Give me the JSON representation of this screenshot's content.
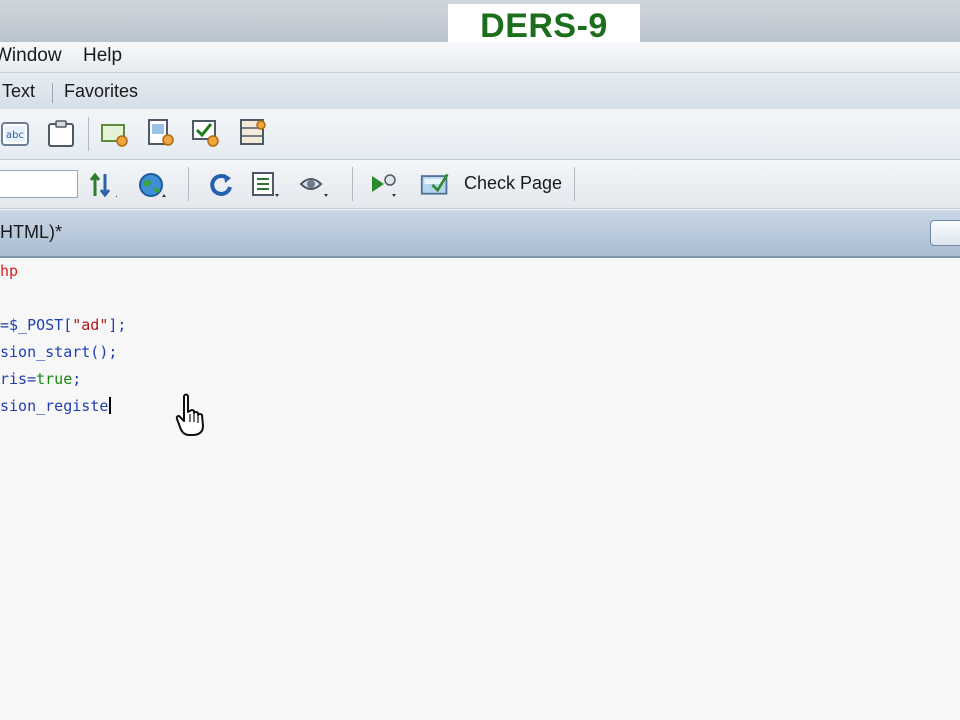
{
  "lesson_badge": "DERS-9",
  "menu": {
    "items": [
      "Window",
      "Help"
    ]
  },
  "insert_bar": {
    "tabs": [
      "Text",
      "Favorites"
    ]
  },
  "document_toolbar": {
    "check_page_label": "Check Page"
  },
  "document_tab": {
    "title": "HTML)*"
  },
  "editor": {
    "lines": [
      {
        "tokens": [
          {
            "t": "hp",
            "c": "kw-red"
          }
        ]
      },
      {
        "tokens": []
      },
      {
        "tokens": [
          {
            "t": "=$_POST[",
            "c": "op"
          },
          {
            "t": "\"ad\"",
            "c": "str"
          },
          {
            "t": "];",
            "c": "op"
          }
        ]
      },
      {
        "tokens": [
          {
            "t": "sion_start();",
            "c": "fn"
          }
        ]
      },
      {
        "tokens": [
          {
            "t": "ris",
            "c": "fn"
          },
          {
            "t": "=",
            "c": "op"
          },
          {
            "t": "true",
            "c": "kw-green"
          },
          {
            "t": ";",
            "c": "op"
          }
        ]
      },
      {
        "tokens": [
          {
            "t": "sion_registe",
            "c": "fn"
          }
        ]
      }
    ]
  },
  "colors": {
    "badge_text": "#1c6e1c",
    "keyword": "#d11f1f",
    "function": "#1f3fb0",
    "string": "#b01818",
    "boolean": "#148a14"
  },
  "icons": [
    "spellcheck-icon",
    "clipboard-icon",
    "insert-div-icon",
    "insert-image-icon",
    "checkbox-icon",
    "table-icon",
    "file-transfer-icon",
    "globe-icon",
    "refresh-icon",
    "view-options-icon",
    "visual-aids-icon",
    "preview-icon",
    "check-page-icon",
    "hand-cursor-icon"
  ]
}
